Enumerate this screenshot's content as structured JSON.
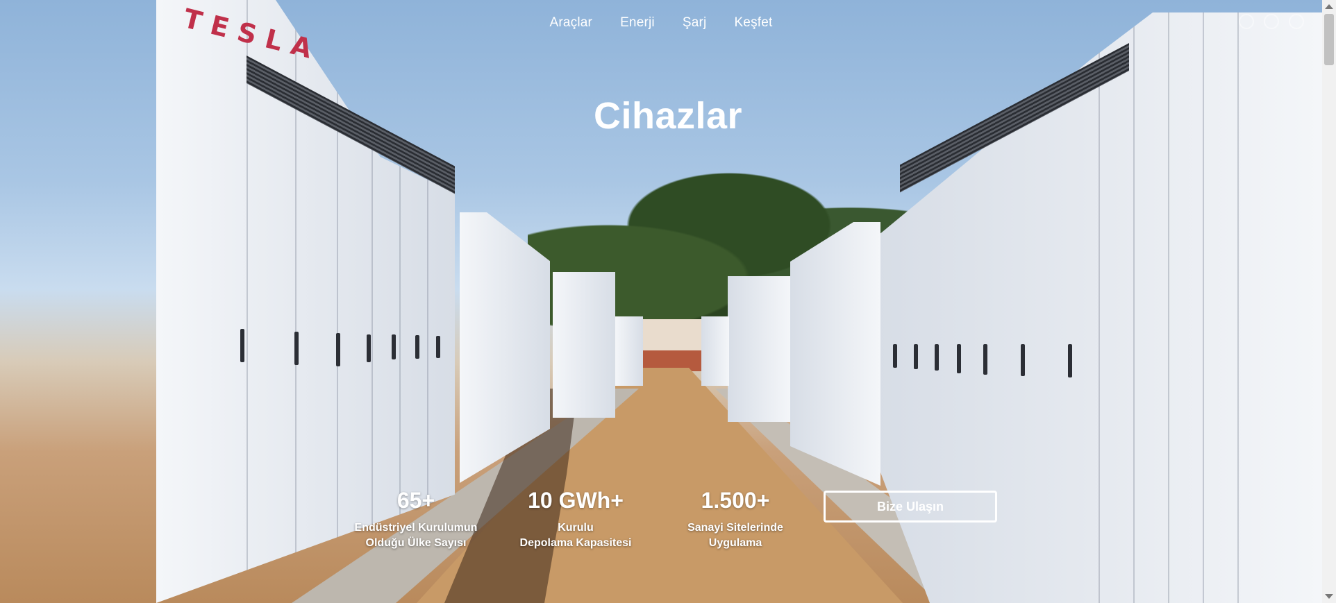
{
  "nav": {
    "items": [
      {
        "label": "Araçlar"
      },
      {
        "label": "Enerji"
      },
      {
        "label": "Şarj"
      },
      {
        "label": "Keşfet"
      }
    ]
  },
  "hero": {
    "title": "Cihazlar",
    "logo_text": "TESLA"
  },
  "stats": [
    {
      "value": "65+",
      "label_line1": "Endüstriyel Kurulumun",
      "label_line2": "Olduğu Ülke Sayısı"
    },
    {
      "value": "10 GWh+",
      "label_line1": "Kurulu",
      "label_line2": "Depolama Kapasitesi"
    },
    {
      "value": "1.500+",
      "label_line1": "Sanayi Sitelerinde",
      "label_line2": "Uygulama"
    }
  ],
  "cta": {
    "label": "Bize Ulaşın"
  },
  "icons": [
    "help-icon",
    "globe-icon",
    "account-icon"
  ]
}
